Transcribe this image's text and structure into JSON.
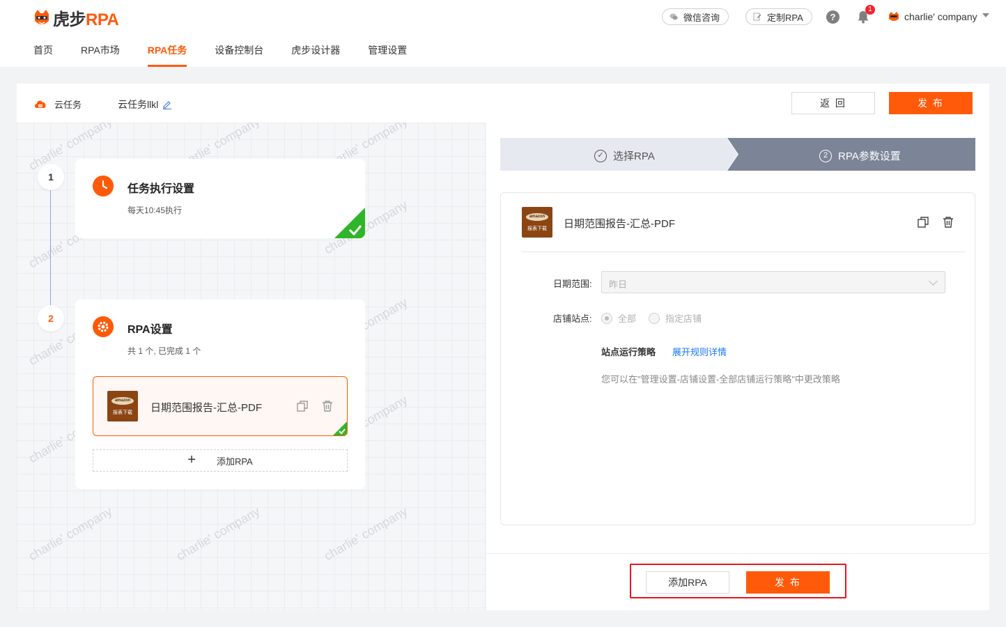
{
  "app": {
    "logo_dark": "虎步",
    "logo_orange": "RPA",
    "brand_color": "#ff5a0a"
  },
  "nav": {
    "items": [
      {
        "label": "首页",
        "active": false
      },
      {
        "label": "RPA市场",
        "active": false
      },
      {
        "label": "RPA任务",
        "active": true
      },
      {
        "label": "设备控制台",
        "active": false
      },
      {
        "label": "虎步设计器",
        "active": false
      },
      {
        "label": "管理设置",
        "active": false
      }
    ]
  },
  "header": {
    "wechat_label": "微信咨询",
    "custom_rpa_label": "定制RPA",
    "help_glyph": "?",
    "notification_count": "1",
    "user_name": "charlie' company"
  },
  "subbar": {
    "crumb_label": "云任务",
    "task_name": "云任务llkl",
    "back_label": "返 回",
    "publish_label": "发 布"
  },
  "canvas": {
    "watermark": "charlie' company",
    "steps": [
      {
        "number": "1",
        "title": "任务执行设置",
        "subtitle": "每天10:45执行",
        "done": true
      },
      {
        "number": "2",
        "title": "RPA设置",
        "subtitle": "共 1 个, 已完成 1 个",
        "done": true
      }
    ],
    "rpa_item": {
      "name": "日期范围报告-汇总-PDF",
      "thumb_top": "amazon",
      "thumb_bottom": "报表下载"
    },
    "add_rpa_label": "添加RPA"
  },
  "panel": {
    "stepper": [
      {
        "number": "✓",
        "label": "选择RPA",
        "active": false
      },
      {
        "number": "2",
        "label": "RPA参数设置",
        "active": true
      }
    ],
    "rpa_name": "日期范围报告-汇总-PDF",
    "form": {
      "date_range_label": "日期范围:",
      "date_range_value": "昨日",
      "store_site_label": "店铺站点:",
      "radio_all": "全部",
      "radio_specific": "指定店铺",
      "policy_title": "站点运行策略",
      "policy_link": "展开规则详情",
      "policy_hint": "您可以在\"管理设置-店铺设置-全部店铺运行策略\"中更改策略"
    },
    "footer": {
      "add_rpa_label": "添加RPA",
      "publish_label": "发 布"
    }
  }
}
